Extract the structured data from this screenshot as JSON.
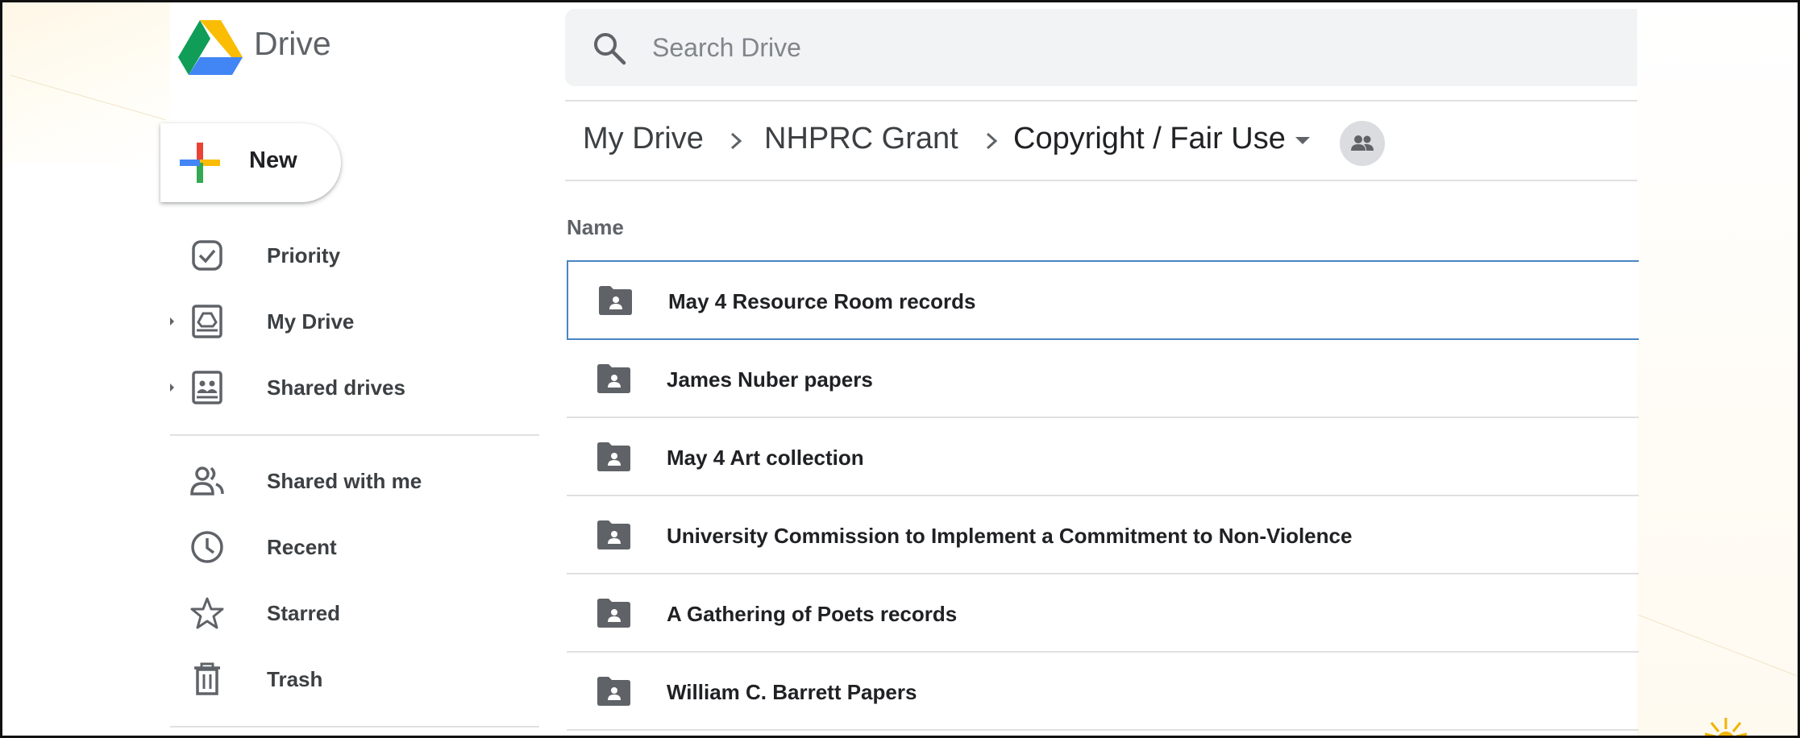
{
  "app": {
    "brand_name": "Drive"
  },
  "search": {
    "placeholder": "Search Drive"
  },
  "sidebar": {
    "new_label": "New",
    "items": [
      {
        "label": "Priority",
        "icon": "priority-check-icon"
      },
      {
        "label": "My Drive",
        "icon": "my-drive-icon",
        "expandable": true
      },
      {
        "label": "Shared drives",
        "icon": "shared-drives-icon",
        "expandable": true
      },
      {
        "label": "Shared with me",
        "icon": "people-icon"
      },
      {
        "label": "Recent",
        "icon": "clock-icon"
      },
      {
        "label": "Starred",
        "icon": "star-icon"
      },
      {
        "label": "Trash",
        "icon": "trash-icon"
      }
    ]
  },
  "breadcrumb": {
    "items": [
      "My Drive",
      "NHPRC Grant",
      "Copyright / Fair Use"
    ],
    "shared_icon": "shared-people-icon"
  },
  "list": {
    "column_header": "Name",
    "files": [
      {
        "name": "May 4 Resource Room records",
        "icon": "shared-folder-icon",
        "selected": true
      },
      {
        "name": "James Nuber papers",
        "icon": "shared-folder-icon"
      },
      {
        "name": "May 4 Art collection",
        "icon": "shared-folder-icon"
      },
      {
        "name": "University Commission to Implement a Commitment to Non-Violence",
        "icon": "shared-folder-icon"
      },
      {
        "name": "A Gathering of Poets records",
        "icon": "shared-folder-icon"
      },
      {
        "name": "William C. Barrett Papers",
        "icon": "shared-folder-icon"
      }
    ]
  },
  "colors": {
    "text_primary": "#202124",
    "text_secondary": "#5f6368",
    "search_bg": "#f1f3f4",
    "selection_border": "#4a84c4",
    "divider": "#e0e0e0",
    "accent_yellow": "#f0b400"
  }
}
